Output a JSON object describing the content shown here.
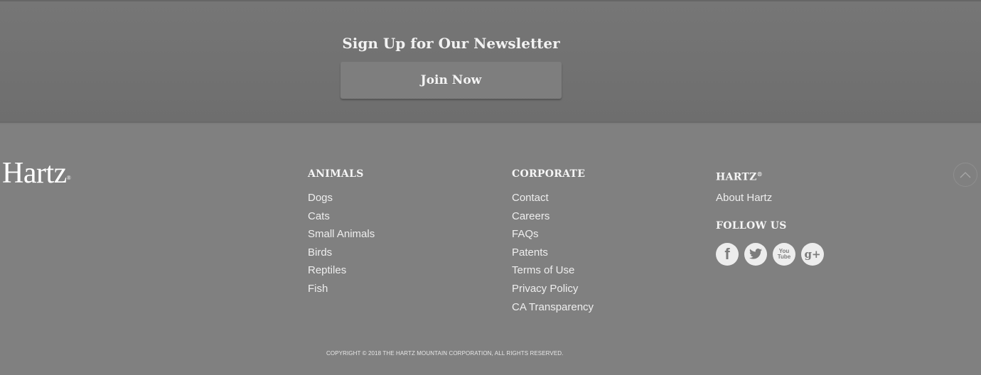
{
  "newsletter": {
    "title": "Sign Up for Our Newsletter",
    "button_label": "Join Now"
  },
  "footer": {
    "logo_text": "Hartz",
    "logo_mark": "®",
    "columns": [
      {
        "heading": "ANIMALS",
        "links": [
          "Dogs",
          "Cats",
          "Small Animals",
          "Birds",
          "Reptiles",
          "Fish"
        ]
      },
      {
        "heading": "CORPORATE",
        "links": [
          "Contact",
          "Careers",
          "FAQs",
          "Patents",
          "Terms of Use",
          "Privacy Policy",
          "CA Transparency"
        ]
      },
      {
        "heading": "HARTZ",
        "heading_mark": "®",
        "links": [
          "About Hartz"
        ]
      }
    ],
    "follow": {
      "heading": "FOLLOW US",
      "icons": [
        {
          "name": "facebook-icon",
          "glyph": "f"
        },
        {
          "name": "twitter-icon",
          "glyph": ""
        },
        {
          "name": "youtube-icon",
          "glyph_top": "You",
          "glyph_bottom": "Tube"
        },
        {
          "name": "google-plus-icon",
          "glyph": "g+"
        }
      ]
    },
    "scroll_top_icon": "chevron-up-icon",
    "copyright": "COPYRIGHT © 2018 THE HARTZ MOUNTAIN CORPORATION, ALL RIGHTS RESERVED."
  }
}
